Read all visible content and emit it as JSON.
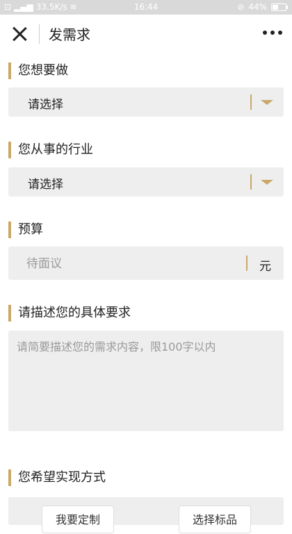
{
  "status_bar": {
    "network_speed": "33.5K/s",
    "time": "16:44",
    "battery": "44%",
    "battery_level": 0.44
  },
  "header": {
    "title": "发需求"
  },
  "sections": {
    "want": {
      "label": "您想要做",
      "value": "请选择"
    },
    "industry": {
      "label": "您从事的行业",
      "value": "请选择"
    },
    "budget": {
      "label": "预算",
      "placeholder": "待面议",
      "unit": "元"
    },
    "description": {
      "label": "请描述您的具体要求",
      "placeholder": "请简要描述您的需求内容，限100字以内"
    },
    "method": {
      "label": "您希望实现方式",
      "options": [
        "我要定制",
        "选择标品"
      ]
    }
  },
  "colors": {
    "accent": "#c9a86a",
    "field_bg": "#eeeeee"
  }
}
